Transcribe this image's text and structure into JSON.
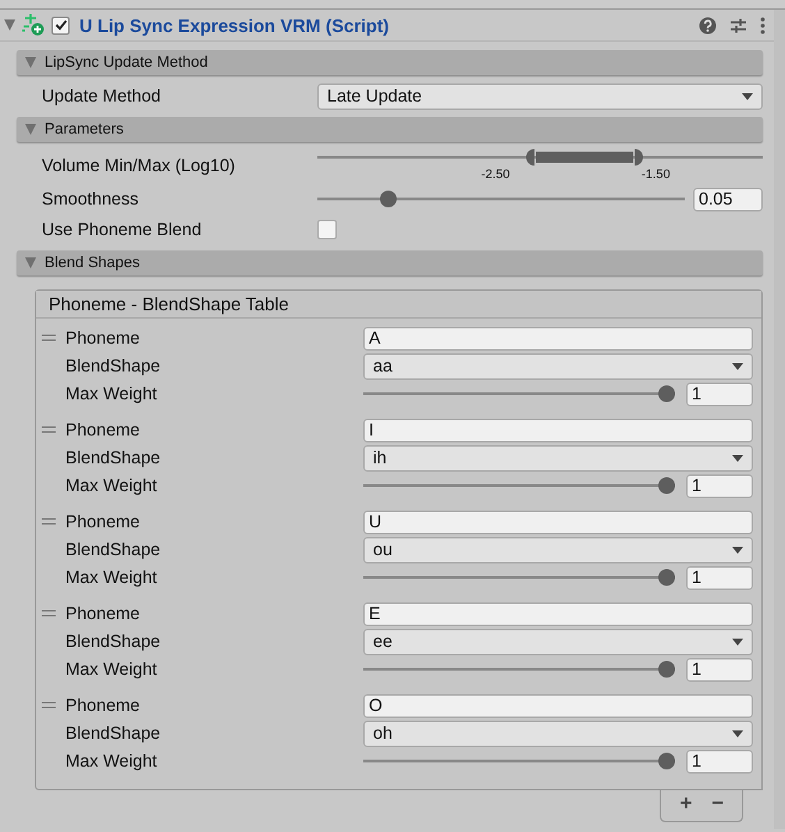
{
  "component": {
    "enabled": true,
    "title": "U Lip Sync Expression VRM (Script)"
  },
  "sections": [
    {
      "title": "LipSync Update Method",
      "expanded": true
    },
    {
      "title": "Parameters",
      "expanded": true
    },
    {
      "title": "Blend Shapes",
      "expanded": true
    }
  ],
  "update_method": {
    "label": "Update Method",
    "value": "Late Update"
  },
  "volume": {
    "label": "Volume Min/Max (Log10)",
    "low": {
      "level": 0.49,
      "reading": "-2.50"
    },
    "high": {
      "level": 0.71,
      "reading": "-1.50"
    }
  },
  "smoothness": {
    "label": "Smoothness",
    "level": 0.18,
    "value": "0.05"
  },
  "phoneme_blend": {
    "label": "Use Phoneme Blend",
    "checked": false
  },
  "table": {
    "title": "Phoneme - BlendShape Table",
    "entries": [
      {
        "phoneme_label": "Phoneme",
        "phoneme": "A",
        "blendshape_label": "BlendShape",
        "blendshape": "aa",
        "weight_label": "Max Weight",
        "level": 1,
        "weight": "1"
      },
      {
        "phoneme_label": "Phoneme",
        "phoneme": "I",
        "blendshape_label": "BlendShape",
        "blendshape": "ih",
        "weight_label": "Max Weight",
        "level": 1,
        "weight": "1"
      },
      {
        "phoneme_label": "Phoneme",
        "phoneme": "U",
        "blendshape_label": "BlendShape",
        "blendshape": "ou",
        "weight_label": "Max Weight",
        "level": 1,
        "weight": "1"
      },
      {
        "phoneme_label": "Phoneme",
        "phoneme": "E",
        "blendshape_label": "BlendShape",
        "blendshape": "ee",
        "weight_label": "Max Weight",
        "level": 1,
        "weight": "1"
      },
      {
        "phoneme_label": "Phoneme",
        "phoneme": "O",
        "blendshape_label": "BlendShape",
        "blendshape": "oh",
        "weight_label": "Max Weight",
        "level": 1,
        "weight": "1"
      }
    ],
    "add": "+",
    "remove": "−"
  }
}
